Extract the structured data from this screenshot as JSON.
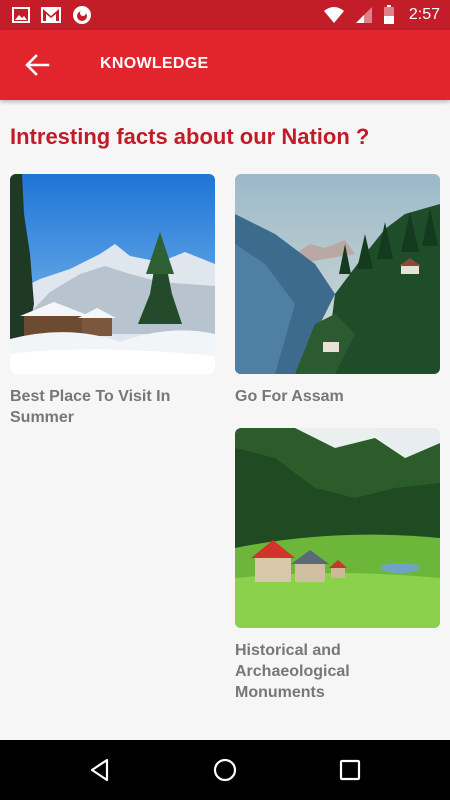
{
  "status_bar": {
    "time": "2:57",
    "icons": [
      "image-icon",
      "gmail-icon",
      "vodafone-icon",
      "wifi-icon",
      "signal-icon",
      "battery-icon"
    ]
  },
  "app_bar": {
    "title": "KNOWLEDGE",
    "back_icon": "arrow-back-icon",
    "color": "#e2242d"
  },
  "heading": "Intresting facts about our Nation ?",
  "cards": [
    {
      "caption": "Best Place To Visit In Summer",
      "image": "snowy-village-photo"
    },
    {
      "caption": "Go For Assam",
      "image": "pine-forest-valley-photo"
    },
    {
      "caption": "Historical and Archaeological Monuments",
      "image": "green-meadow-hill-photo"
    }
  ],
  "nav_bar": {
    "icons": [
      "back-triangle-icon",
      "home-circle-icon",
      "recents-square-icon"
    ]
  },
  "colors": {
    "accent": "#c11b27",
    "status_bar": "#c21d28",
    "caption": "#777777"
  }
}
